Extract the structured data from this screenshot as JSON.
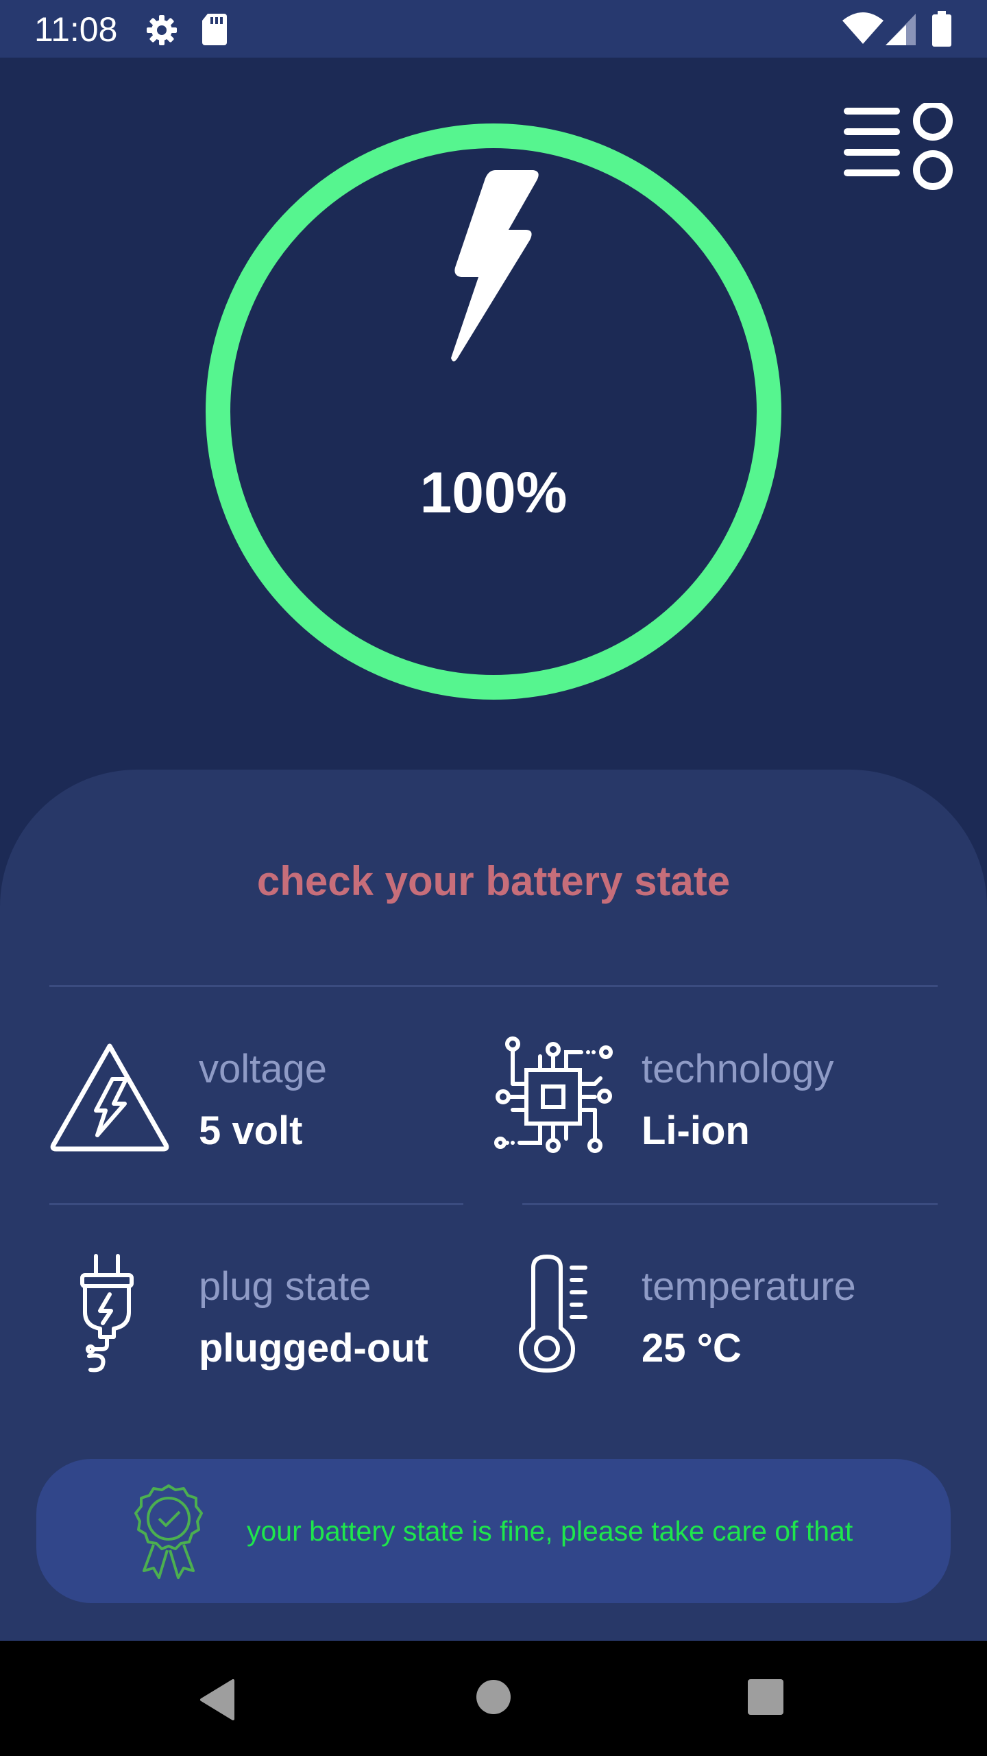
{
  "status_bar": {
    "time": "11:08",
    "icons": [
      "gear-icon",
      "sd-card-icon",
      "wifi-icon",
      "signal-icon",
      "battery-icon"
    ]
  },
  "menu": {
    "icon": "settings-menu-icon"
  },
  "battery": {
    "level_percent": 100,
    "level_text": "100%",
    "ring_color": "#56f58f",
    "icon": "lightning-bolt-icon"
  },
  "panel": {
    "title": "check your battery state",
    "title_color": "#c76e7a",
    "items": [
      {
        "label": "voltage",
        "value": "5 volt",
        "icon": "high-voltage-warning-icon"
      },
      {
        "label": "technology",
        "value": "Li-ion",
        "icon": "circuit-chip-icon"
      },
      {
        "label": "plug state",
        "value": "plugged-out",
        "icon": "power-plug-icon"
      },
      {
        "label": "temperature",
        "value": "25 °C",
        "icon": "thermometer-icon"
      }
    ]
  },
  "banner": {
    "message": "your battery state is fine, please take care of that",
    "message_color": "#1ee64c",
    "icon": "award-badge-icon"
  },
  "nav_bar": {
    "buttons": [
      "back-icon",
      "home-icon",
      "recents-icon"
    ]
  }
}
